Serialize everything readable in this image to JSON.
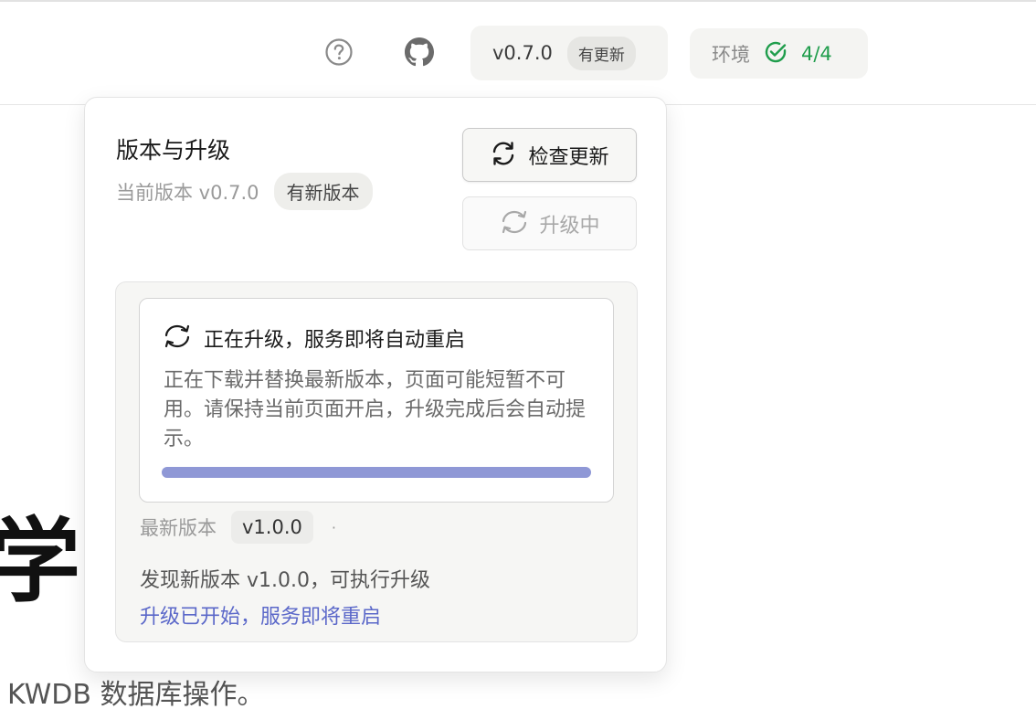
{
  "header": {
    "version_label": "v0.7.0",
    "update_badge": "有更新",
    "env_label": "环境",
    "env_count": "4/4",
    "icons": [
      "help-circle-icon",
      "github-icon",
      "check-circle-icon"
    ]
  },
  "background": {
    "heading_fragment": "学",
    "desc_fragment": "KWDB 数据库操作。"
  },
  "popover": {
    "title": "版本与升级",
    "current_version": "当前版本 v0.7.0",
    "new_version_badge": "有新版本",
    "check_button": "检查更新",
    "upgrading_button": "升级中",
    "notice": {
      "title": "正在升级，服务即将自动重启",
      "body": "正在下载并替换最新版本，页面可能短暂不可用。请保持当前页面开启，升级完成后会自动提示。",
      "progress": 1.0
    },
    "latest_label": "最新版本",
    "latest_version": "v1.0.0",
    "separator": "·",
    "found_text": "发现新版本 v1.0.0，可执行升级",
    "started_text": "升级已开始，服务即将重启"
  },
  "colors": {
    "accent_green": "#1f9d4c",
    "link_blue": "#5b68c9",
    "progress": "#8f98d6"
  }
}
